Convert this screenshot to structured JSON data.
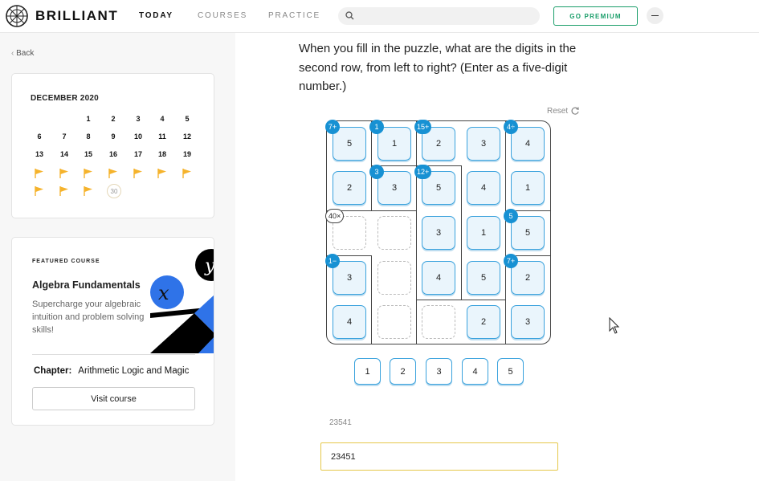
{
  "header": {
    "brand": "BRILLIANT",
    "nav": [
      "TODAY",
      "COURSES",
      "PRACTICE"
    ],
    "active_nav": "TODAY",
    "search_placeholder": "",
    "premium_label": "GO PREMIUM"
  },
  "sidebar": {
    "back_label": "Back",
    "calendar": {
      "title": "DECEMBER 2020",
      "rows": [
        [
          "",
          "",
          "1",
          "2",
          "3",
          "4",
          "5"
        ],
        [
          "6",
          "7",
          "8",
          "9",
          "10",
          "11",
          "12"
        ],
        [
          "13",
          "14",
          "15",
          "16",
          "17",
          "18",
          "19"
        ],
        [
          "flag",
          "flag",
          "flag",
          "flag",
          "flag",
          "flag",
          "flag"
        ],
        [
          "flag",
          "flag",
          "flag",
          "30",
          "",
          "",
          ""
        ]
      ]
    },
    "featured": {
      "kicker": "FEATURED COURSE",
      "title": "Algebra Fundamentals",
      "description": "Supercharge your algebraic intuition and problem solving skills!",
      "chapter_label": "Chapter:",
      "chapter_name": "Arithmetic Logic and Magic",
      "visit_label": "Visit course"
    }
  },
  "puzzle": {
    "question": "When you fill in the puzzle, what are the digits in the second row, from left to right? (Enter as a five-digit number.)",
    "reset_label": "Reset",
    "cells": [
      [
        "5",
        "1",
        "2",
        "3",
        "4"
      ],
      [
        "2",
        "3",
        "5",
        "4",
        "1"
      ],
      [
        "",
        "",
        "3",
        "1",
        "5"
      ],
      [
        "3",
        "",
        "4",
        "5",
        "2"
      ],
      [
        "4",
        "",
        "",
        "2",
        "3"
      ]
    ],
    "cage_labels": [
      "7+",
      "1",
      "15+",
      "4÷",
      "3",
      "12+",
      "40×",
      "5",
      "1−",
      "7+"
    ],
    "choices": [
      "1",
      "2",
      "3",
      "4",
      "5"
    ],
    "hint_text": "23541",
    "answer_value": "23451"
  },
  "colors": {
    "accent_blue": "#1791d3",
    "premium_green": "#1a9e6a",
    "flag_yellow": "#f5b32c",
    "answer_border": "#e5c84a"
  }
}
